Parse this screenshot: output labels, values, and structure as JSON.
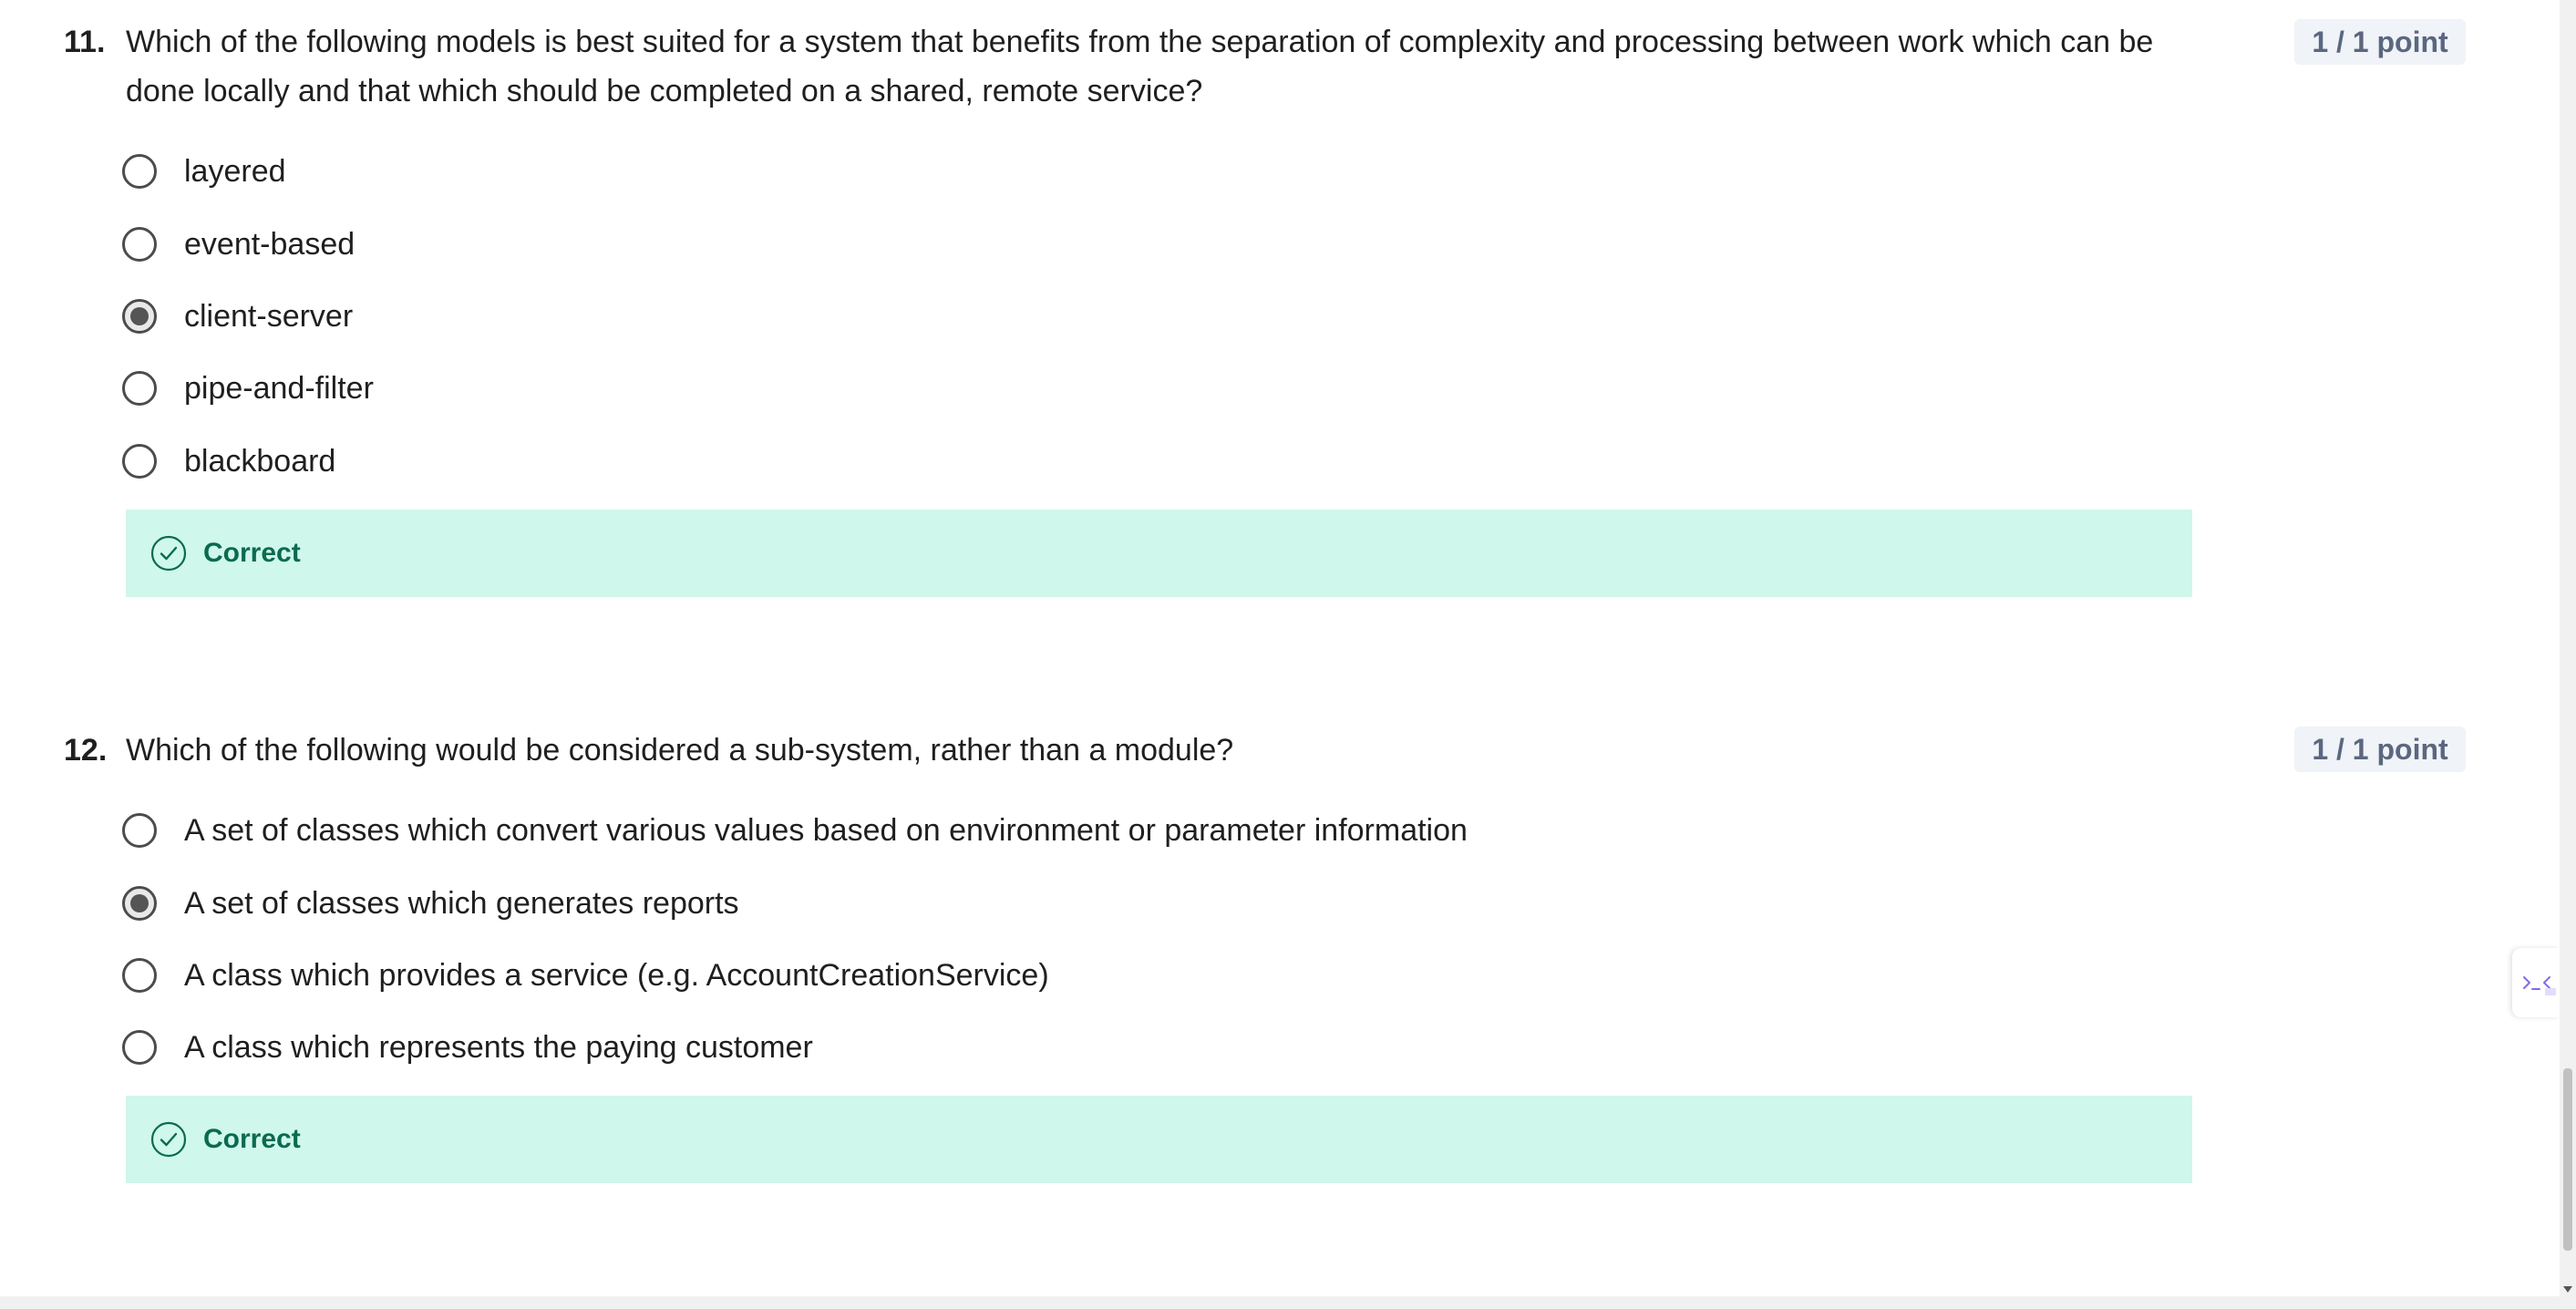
{
  "questions": [
    {
      "number": "11.",
      "text": "Which of the following models is best suited for a system that benefits from the separation of complexity and processing between work which can be done locally and that which should be completed on a shared, remote service?",
      "points": "1 / 1 point",
      "options": [
        {
          "label": "layered",
          "selected": false
        },
        {
          "label": "event-based",
          "selected": false
        },
        {
          "label": "client-server",
          "selected": true
        },
        {
          "label": "pipe-and-filter",
          "selected": false
        },
        {
          "label": "blackboard",
          "selected": false
        }
      ],
      "feedback": "Correct"
    },
    {
      "number": "12.",
      "text": "Which of the following would be considered a sub-system, rather than a module?",
      "points": "1 / 1 point",
      "options": [
        {
          "label": "A set of classes which convert various values based on environment or parameter information",
          "selected": false
        },
        {
          "label": "A set of classes which generates reports",
          "selected": true
        },
        {
          "label": "A class which provides a service (e.g. AccountCreationService)",
          "selected": false
        },
        {
          "label": "A class which represents the paying customer",
          "selected": false
        }
      ],
      "feedback": "Correct"
    }
  ],
  "colors": {
    "feedback_bg": "#d0f7ec",
    "feedback_text": "#0a6b4e",
    "points_bg": "#f0f3f7",
    "points_text": "#5b6780"
  },
  "icons": {
    "feedback": "check-circle-icon",
    "side_widget": "assistant-icon"
  }
}
